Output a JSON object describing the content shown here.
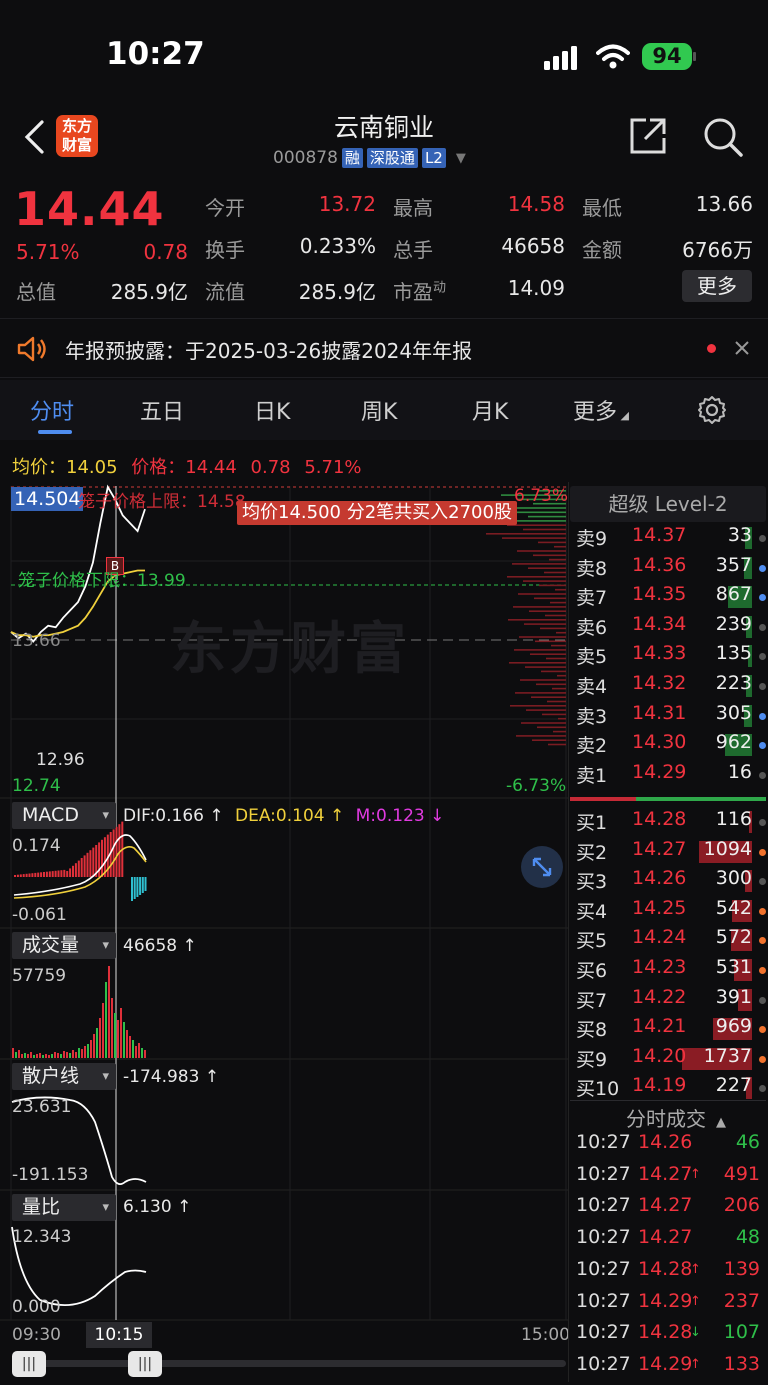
{
  "status_bar": {
    "time": "10:27",
    "battery": "94"
  },
  "header": {
    "logo_text": "东方财富",
    "stock_name": "云南铜业",
    "stock_code": "000878",
    "tags": [
      "融",
      "深股通",
      "L2"
    ]
  },
  "quote": {
    "price": "14.44",
    "change_pct": "5.71%",
    "change": "0.78",
    "open_label": "今开",
    "open": "13.72",
    "high_label": "最高",
    "high": "14.58",
    "low_label": "最低",
    "low": "13.66",
    "turnover_label": "换手",
    "turnover": "0.233%",
    "volume_label": "总手",
    "volume": "46658",
    "amount_label": "金额",
    "amount": "6766万",
    "mktcap_label": "总值",
    "mktcap": "285.9亿",
    "float_label": "流值",
    "float_cap": "285.9亿",
    "pe_label": "市盈",
    "pe_sup": "动",
    "pe": "14.09",
    "more_label": "更多"
  },
  "notice": {
    "text": "年报预披露：于2025-03-26披露2024年年报"
  },
  "tabs": [
    "分时",
    "五日",
    "日K",
    "周K",
    "月K",
    "更多"
  ],
  "chart_header": {
    "avg_label": "均价：",
    "avg": "14.05",
    "price_label": "价格：",
    "price": "14.44",
    "change": "0.78",
    "change_pct": "5.71%"
  },
  "chart_labels": {
    "y_top": "14.504",
    "y_top_pct": "6.73%",
    "cage_upper": "笼子价格上限：14.58",
    "cage_lower": "笼子价格下限：13.99",
    "prev_close": "13.66",
    "y_low": "12.96",
    "y_bottom": "12.74",
    "y_bottom_pct": "-6.73%",
    "trade_tip": "均价14.500  分2笔共买入2700股",
    "watermark": "东方财富",
    "b_marker": "B"
  },
  "chart_data": [
    {
      "type": "line",
      "title": "分时",
      "series": [
        {
          "name": "价格",
          "values": [
            13.66,
            13.62,
            13.65,
            13.6,
            13.66,
            13.7,
            13.69,
            13.75,
            13.8,
            13.85,
            13.95,
            14.1,
            14.35,
            14.58,
            14.5,
            14.4,
            14.35,
            14.3,
            14.44
          ]
        },
        {
          "name": "均价",
          "values": [
            13.66,
            13.64,
            13.64,
            13.63,
            13.64,
            13.64,
            13.65,
            13.66,
            13.68,
            13.7,
            13.75,
            13.82,
            13.9,
            13.98,
            14.02,
            14.03,
            14.04,
            14.05,
            14.05
          ]
        }
      ],
      "ylim": [
        12.74,
        14.58
      ]
    },
    {
      "type": "bar",
      "title": "MACD",
      "labels": {
        "dif": "DIF:0.166 ↑",
        "dea": "DEA:0.104 ↑",
        "m": "M:0.123 ↓",
        "max": "0.174",
        "min": "-0.061"
      }
    },
    {
      "type": "bar",
      "title": "成交量",
      "labels": {
        "value": "46658 ↑",
        "max": "57759"
      }
    },
    {
      "type": "line",
      "title": "散户线",
      "labels": {
        "value": "-174.983 ↑",
        "max": "23.631",
        "min": "-191.153"
      }
    },
    {
      "type": "line",
      "title": "量比",
      "labels": {
        "value": "6.130 ↑",
        "max": "12.343",
        "min": "0.000"
      }
    }
  ],
  "x_axis": {
    "start": "09:30",
    "cursor": "10:15",
    "end": "15:00"
  },
  "level2": {
    "title": "超级 Level-2"
  },
  "sell_orders": [
    {
      "label": "卖9",
      "price": "14.37",
      "vol": "33",
      "bar": 0.05,
      "dot": "#555"
    },
    {
      "label": "卖8",
      "price": "14.36",
      "vol": "357",
      "bar": 0.06,
      "dot": "#4f8df0"
    },
    {
      "label": "卖7",
      "price": "14.35",
      "vol": "867",
      "bar": 0.17,
      "dot": "#4f8df0"
    },
    {
      "label": "卖6",
      "price": "14.34",
      "vol": "239",
      "bar": 0.04,
      "dot": "#555"
    },
    {
      "label": "卖5",
      "price": "14.33",
      "vol": "135",
      "bar": 0.03,
      "dot": "#555"
    },
    {
      "label": "卖4",
      "price": "14.32",
      "vol": "223",
      "bar": 0.04,
      "dot": "#555"
    },
    {
      "label": "卖3",
      "price": "14.31",
      "vol": "305",
      "bar": 0.06,
      "dot": "#4f8df0"
    },
    {
      "label": "卖2",
      "price": "14.30",
      "vol": "962",
      "bar": 0.19,
      "dot": "#4f8df0"
    },
    {
      "label": "卖1",
      "price": "14.29",
      "vol": "16",
      "bar": 0.0,
      "dot": "#555"
    }
  ],
  "buy_orders": [
    {
      "label": "买1",
      "price": "14.28",
      "vol": "116",
      "bar": 0.02,
      "dot": "#555"
    },
    {
      "label": "买2",
      "price": "14.27",
      "vol": "1094",
      "bar": 0.38,
      "dot": "#f0712c"
    },
    {
      "label": "买3",
      "price": "14.26",
      "vol": "300",
      "bar": 0.05,
      "dot": "#555"
    },
    {
      "label": "买4",
      "price": "14.25",
      "vol": "542",
      "bar": 0.14,
      "dot": "#f0712c"
    },
    {
      "label": "买5",
      "price": "14.24",
      "vol": "572",
      "bar": 0.15,
      "dot": "#f0712c"
    },
    {
      "label": "买6",
      "price": "14.23",
      "vol": "531",
      "bar": 0.13,
      "dot": "#f0712c"
    },
    {
      "label": "买7",
      "price": "14.22",
      "vol": "391",
      "bar": 0.1,
      "dot": "#555"
    },
    {
      "label": "买8",
      "price": "14.21",
      "vol": "969",
      "bar": 0.28,
      "dot": "#f0712c"
    },
    {
      "label": "买9",
      "price": "14.20",
      "vol": "1737",
      "bar": 0.5,
      "dot": "#f0712c"
    },
    {
      "label": "买10",
      "price": "14.19",
      "vol": "227",
      "bar": 0.04,
      "dot": "#555"
    }
  ],
  "trades_title": "分时成交",
  "trades": [
    {
      "time": "10:27",
      "price": "14.26",
      "arrow": "",
      "vol": "46",
      "color": "green"
    },
    {
      "time": "10:27",
      "price": "14.27",
      "arrow": "↑",
      "vol": "491",
      "color": "red"
    },
    {
      "time": "10:27",
      "price": "14.27",
      "arrow": "",
      "vol": "206",
      "color": "red"
    },
    {
      "time": "10:27",
      "price": "14.27",
      "arrow": "",
      "vol": "48",
      "color": "green"
    },
    {
      "time": "10:27",
      "price": "14.28",
      "arrow": "↑",
      "vol": "139",
      "color": "red"
    },
    {
      "time": "10:27",
      "price": "14.29",
      "arrow": "↑",
      "vol": "237",
      "color": "red"
    },
    {
      "time": "10:27",
      "price": "14.28",
      "arrow": "↓",
      "vol": "107",
      "color": "green"
    },
    {
      "time": "10:27",
      "price": "14.29",
      "arrow": "↑",
      "vol": "133",
      "color": "red"
    }
  ]
}
